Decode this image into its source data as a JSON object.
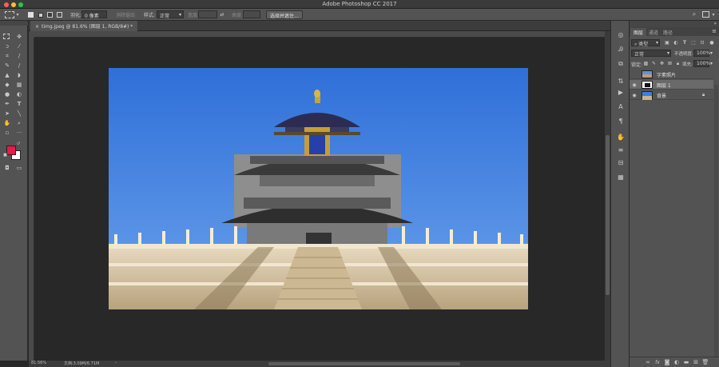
{
  "window": {
    "title": "Adobe Photoshop CC 2017"
  },
  "options_bar": {
    "feather_label": "羽化:",
    "feather_value": "0 像素",
    "antialias_label": "消除锯齿",
    "style_label": "样式:",
    "style_value": "正常",
    "width_label": "宽度:",
    "height_label": "高度:",
    "select_mask_button": "选择并遮住..."
  },
  "document": {
    "tab_label": "timg.jpeg @ 81.6% (图层 1, RGB/8#) *",
    "zoom": "81.56%",
    "doc_size": "文档:3.09M/6.71M"
  },
  "panel": {
    "tabs": [
      "图层",
      "通道",
      "路径"
    ],
    "active_tab": 0,
    "filter_kind": "类型",
    "blend_mode": "正常",
    "opacity_label": "不透明度:",
    "opacity_value": "100%",
    "lock_label": "锁定:",
    "fill_label": "填充:",
    "fill_value": "100%",
    "layers": [
      {
        "name": "字素照片",
        "visible": false,
        "selected": false,
        "locked": false
      },
      {
        "name": "图层 1",
        "visible": true,
        "selected": true,
        "locked": false
      },
      {
        "name": "背景",
        "visible": true,
        "selected": false,
        "locked": true
      }
    ]
  },
  "colors": {
    "foreground": "#e6194b",
    "background": "#ffffff",
    "sky": "#3d7de0",
    "selection_box": "#9a9a9a"
  },
  "icons": {
    "tools": [
      "marquee-icon",
      "move-icon",
      "lasso-icon",
      "magic-wand-icon",
      "crop-icon",
      "eyedropper-icon",
      "healing-brush-icon",
      "brush-icon",
      "clone-stamp-icon",
      "history-brush-icon",
      "eraser-icon",
      "gradient-icon",
      "blur-icon",
      "dodge-icon",
      "pen-icon",
      "type-icon",
      "path-selection-icon",
      "line-icon",
      "hand-icon",
      "zoom-icon",
      "more-tools-icon"
    ],
    "right_strip": [
      "history-icon",
      "character-icon",
      "clone-source-icon",
      "actions-icon",
      "play-icon",
      "text-icon",
      "paragraph-icon",
      "brush-settings-icon",
      "adjustments-icon",
      "properties-icon",
      "swatches-icon"
    ]
  }
}
